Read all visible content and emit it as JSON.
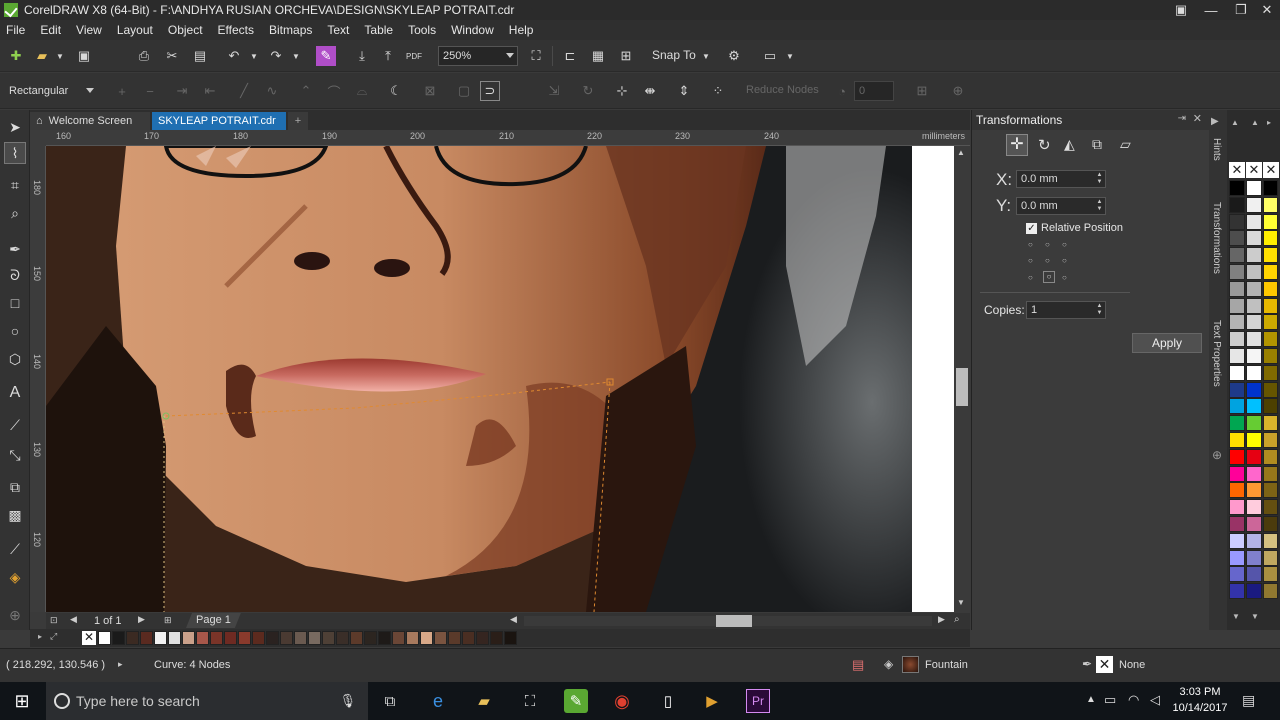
{
  "window": {
    "title": "CorelDRAW X8 (64-Bit) - F:\\ANDHYA RUSIAN ORCHEVA\\DESIGN\\SKYLEAP POTRAIT.cdr"
  },
  "menu": [
    "File",
    "Edit",
    "View",
    "Layout",
    "Object",
    "Effects",
    "Bitmaps",
    "Text",
    "Table",
    "Tools",
    "Window",
    "Help"
  ],
  "standard_toolbar": {
    "zoom_value": "250%",
    "snap_to_label": "Snap To"
  },
  "property_bar": {
    "selection_mode": "Rectangular",
    "reduce_nodes_label": "Reduce Nodes",
    "curve_smoothness": "0"
  },
  "tabs": [
    {
      "label": "Welcome Screen",
      "active": false
    },
    {
      "label": "SKYLEAP POTRAIT.cdr",
      "active": true
    }
  ],
  "ruler": {
    "units": "millimeters",
    "h_labels": [
      "160",
      "170",
      "180",
      "190",
      "200",
      "210",
      "220",
      "230",
      "240"
    ],
    "v_labels": [
      "180",
      "150",
      "140",
      "130",
      "120"
    ]
  },
  "page_nav": {
    "counter": "1 of 1",
    "page_tab": "Page 1"
  },
  "docker": {
    "title": "Transformations",
    "x_value": "0.0 mm",
    "y_value": "0.0 mm",
    "x_label": "X:",
    "y_label": "Y:",
    "relative_position_label": "Relative Position",
    "relative_position_checked": true,
    "copies_label": "Copies:",
    "copies_value": "1",
    "apply_label": "Apply"
  },
  "side_tabs": [
    "Hints",
    "Transformations",
    "Text Properties"
  ],
  "status": {
    "coordinates": "( 218.292, 130.546 )",
    "selection_info": "Curve: 4 Nodes",
    "fill_label": "Fountain",
    "outline_label": "None"
  },
  "taskbar": {
    "search_placeholder": "Type here to search",
    "time": "3:03 PM",
    "date": "10/14/2017"
  },
  "colors": {
    "accent_active_tab": "#1f6fb2",
    "skin": "#c9906a",
    "lips": "#b8564f",
    "hair": "#3a2418"
  },
  "palette_strip": [
    "#ffffff",
    "#1a1a1a",
    "#3b2a22",
    "#5a2a20",
    "#f2f2f2",
    "#e0e0e0",
    "#caa08a",
    "#a8574a",
    "#7a3428",
    "#6e2a22",
    "#8a3a2c",
    "#5c2a1e",
    "#2a2220",
    "#4a3a32",
    "#6a5a50",
    "#786a60",
    "#4e4036",
    "#3a2e28",
    "#5c3a2a",
    "#2c2520",
    "#1e1a18",
    "#6a4636",
    "#a87a5e",
    "#d8a888",
    "#7a5440",
    "#5a3a2a",
    "#4a2e22",
    "#352520",
    "#2a1e18",
    "#1a1410"
  ],
  "color_palette": [
    [
      "#000000",
      "#ffffff"
    ],
    [
      "#1a1a1a",
      "#f0f0f0"
    ],
    [
      "#333333",
      "#e6e6e6"
    ],
    [
      "#4d4d4d",
      "#d9d9d9"
    ],
    [
      "#666666",
      "#cccccc"
    ],
    [
      "#808080",
      "#bfbfbf"
    ],
    [
      "#999999",
      "#b3b3b3"
    ],
    [
      "#a6a6a6",
      "#c0c0c0"
    ],
    [
      "#b3b3b3",
      "#d4d4d4"
    ],
    [
      "#cccccc",
      "#e0e0e0"
    ],
    [
      "#e6e6e6",
      "#f5f5f5"
    ],
    [
      "#ffffff",
      "#ffffff"
    ],
    [
      "#1e3a8a",
      "#0033cc"
    ],
    [
      "#00a3e0",
      "#00c0ff"
    ],
    [
      "#00a651",
      "#66cc33"
    ],
    [
      "#ffde00",
      "#ffff00"
    ],
    [
      "#ff0000",
      "#e60012"
    ],
    [
      "#ff0099",
      "#ff66cc"
    ],
    [
      "#ff6600",
      "#ff9933"
    ],
    [
      "#ff99cc",
      "#ffccdd"
    ],
    [
      "#993366",
      "#cc6699"
    ],
    [
      "#ccccff",
      "#b3b3e6"
    ],
    [
      "#9999ff",
      "#8080cc"
    ],
    [
      "#6666cc",
      "#5555aa"
    ],
    [
      "#3333aa",
      "#1a1a80"
    ]
  ],
  "palette_right_column": [
    "#000000",
    "#ffff66",
    "#ffff33",
    "#ffee00",
    "#ffe000",
    "#ffd400",
    "#ffc800",
    "#e6b800",
    "#ccaa00",
    "#b39500",
    "#998000",
    "#806a00",
    "#665500",
    "#4d4000",
    "#d9b32b",
    "#c9a12a",
    "#b08c20",
    "#96771a",
    "#7d6315",
    "#644f10",
    "#4b3b0c",
    "#d4c080",
    "#c0a860",
    "#aa9040",
    "#907830"
  ]
}
